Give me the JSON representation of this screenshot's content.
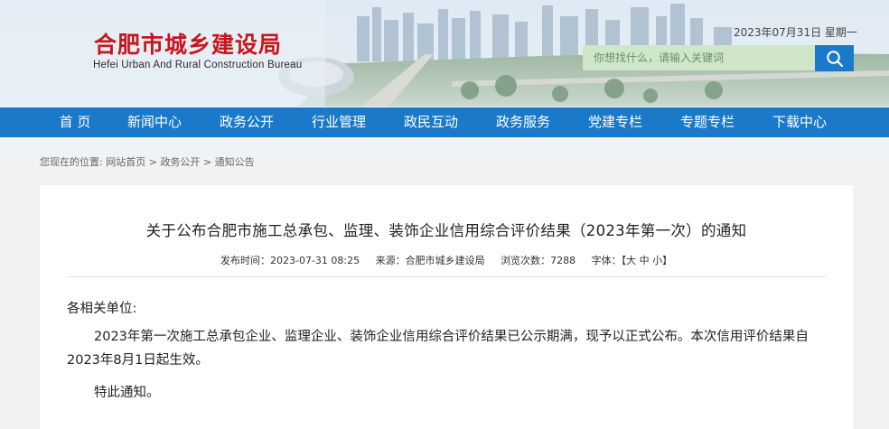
{
  "header": {
    "title_cn": "合肥市城乡建设局",
    "title_en": "Hefei Urban And Rural Construction Bureau",
    "date": "2023年07月31日 星期一",
    "search_placeholder": "你想找什么，请输入关键词"
  },
  "nav": {
    "items": [
      "首 页",
      "新闻中心",
      "政务公开",
      "行业管理",
      "政民互动",
      "政务服务",
      "党建专栏",
      "专题专栏",
      "下载中心"
    ]
  },
  "breadcrumb": {
    "prefix": "您现在的位置:",
    "items": [
      "网站首页",
      "政务公开",
      "通知公告"
    ],
    "sep": " > "
  },
  "article": {
    "title": "关于公布合肥市施工总承包、监理、装饰企业信用综合评价结果（2023年第一次）的通知",
    "meta": {
      "publish": "发布时间：2023-07-31 08:25",
      "source": "来源：合肥市城乡建设局",
      "views": "浏览次数：7288",
      "font_label": "字体：",
      "font_open": "【",
      "font_large": "大",
      "font_mid": "中",
      "font_small": "小",
      "font_close": "】"
    },
    "salutation": "各相关单位:",
    "body": "2023年第一次施工总承包企业、监理企业、装饰企业信用综合评价结果已公示期满，现予以正式公布。本次信用评价结果自2023年8月1日起生效。",
    "closing": "特此通知。"
  },
  "colors": {
    "nav_bg": "#1a79c8",
    "logo_red": "#c8161d",
    "search_bg": "#cfe7c8",
    "search_btn": "#1a7ac9"
  }
}
